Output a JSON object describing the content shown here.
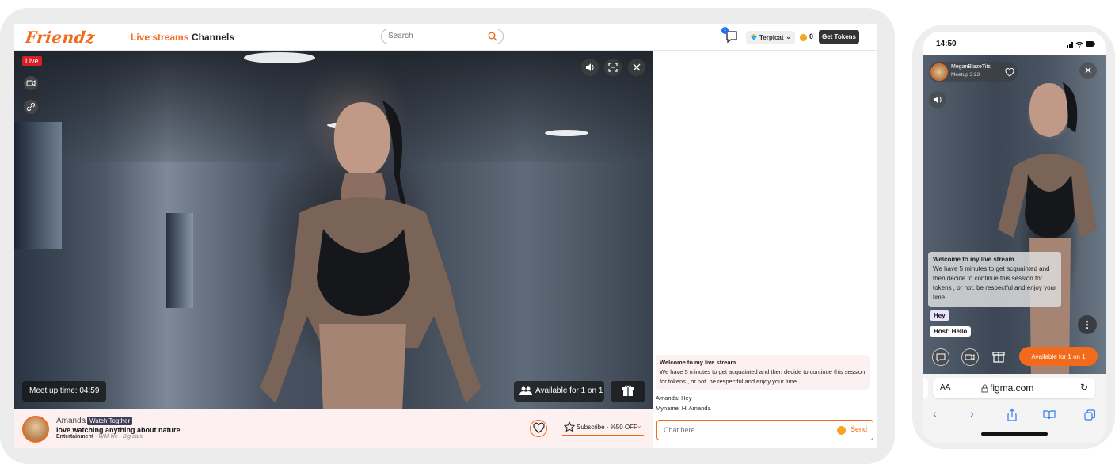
{
  "desktop": {
    "logo": "Friendz",
    "nav": {
      "live": "Live streams",
      "channels": "Channels"
    },
    "search": {
      "placeholder": "Search"
    },
    "messages_badge": "1",
    "user": {
      "name": "Terpicat"
    },
    "tokens": {
      "count": "0",
      "get_label": "Get Tokens"
    },
    "video": {
      "live_label": "Live",
      "meetup_time": "Meet up time: 04:59",
      "available_label": "Available for 1 on 1"
    },
    "info": {
      "host_name": "Amanda",
      "tag": "Watch Togther",
      "description": "love watching anything about nature",
      "category": "Entertainment",
      "subcategory": "- Wild life - Big cats",
      "subscribe_label": "Subscribe - %50 OFF"
    },
    "chat": {
      "welcome_title": "Welcome to my live stream",
      "welcome_body": "We have 5 minutes to get acquainted and then decide to continue this session for tokens , or not. be respectful and enjoy your time",
      "messages": [
        "Amanda: Hey",
        "Myname: Hi Amanda"
      ],
      "input_placeholder": "Chat here",
      "send_label": "Send"
    }
  },
  "phone": {
    "time": "14:50",
    "host_name": "MeganBlazeTits",
    "host_sub": "Meetup 3:23",
    "welcome_title": "Welcome to my live stream",
    "welcome_body": "We have 5 minutes to get acquainted and then decide to continue this session for tokens , or not. be respectful and enjoy your time",
    "msg_hey": "Hey",
    "msg_host": "Host: Hello",
    "available_label": "Available for 1 on 1",
    "browser": {
      "aa": "AA",
      "domain": "figma.com"
    }
  },
  "colors": {
    "accent": "#f26a1b",
    "live": "#d61f26",
    "link": "#2f7cf6"
  }
}
